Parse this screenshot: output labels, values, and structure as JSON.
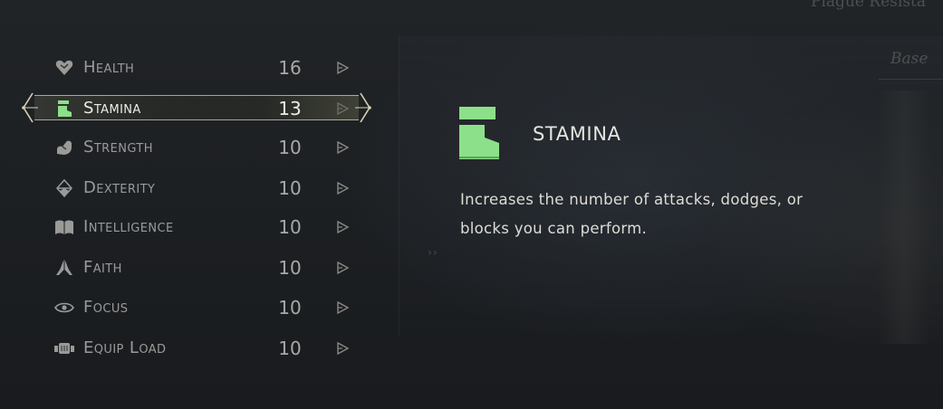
{
  "background": {
    "top_label": "Plague Resista",
    "base_label": "Base"
  },
  "colors": {
    "selected_icon": "#8de08a",
    "text_normal": "#9a9a98",
    "text_selected": "#ecebe6",
    "frame_accent": "#d6d1b4"
  },
  "stats": [
    {
      "label": "Health",
      "value": "16",
      "icon": "heart-icon"
    },
    {
      "label": "Stamina",
      "value": "13",
      "icon": "stamina-boot-icon",
      "selected": true
    },
    {
      "label": "Strength",
      "value": "10",
      "icon": "strength-arm-icon"
    },
    {
      "label": "Dexterity",
      "value": "10",
      "icon": "dexterity-icon"
    },
    {
      "label": "Intelligence",
      "value": "10",
      "icon": "book-icon"
    },
    {
      "label": "Faith",
      "value": "10",
      "icon": "praying-hands-icon"
    },
    {
      "label": "Focus",
      "value": "10",
      "icon": "eye-icon"
    },
    {
      "label": "Equip Load",
      "value": "10",
      "icon": "equip-load-icon"
    }
  ],
  "detail": {
    "title": "STAMINA",
    "icon": "stamina-boot-icon",
    "description": "Increases the number of attacks, dodges, or blocks you can perform."
  }
}
